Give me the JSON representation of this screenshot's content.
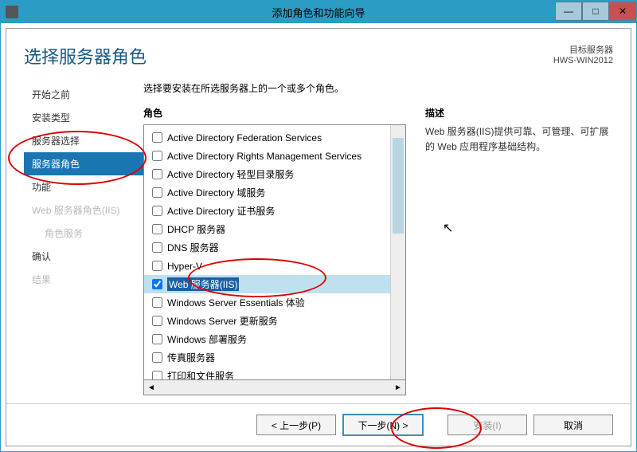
{
  "window": {
    "title": "添加角色和功能向导",
    "wizard_title": "选择服务器角色",
    "target_label": "目标服务器",
    "target_server": "HWS-WIN2012"
  },
  "nav": {
    "items": [
      {
        "label": "开始之前",
        "state": "done"
      },
      {
        "label": "安装类型",
        "state": "done"
      },
      {
        "label": "服务器选择",
        "state": "done"
      },
      {
        "label": "服务器角色",
        "state": "active"
      },
      {
        "label": "功能",
        "state": "done"
      },
      {
        "label": "Web 服务器角色(IIS)",
        "state": "disabled"
      },
      {
        "label": "角色服务",
        "state": "disabled",
        "sub": true
      },
      {
        "label": "确认",
        "state": "done"
      },
      {
        "label": "结果",
        "state": "disabled"
      }
    ]
  },
  "main": {
    "instruction": "选择要安装在所选服务器上的一个或多个角色。",
    "roles_header": "角色",
    "desc_header": "描述",
    "desc_text": "Web 服务器(IIS)提供可靠、可管理、可扩展的 Web 应用程序基础结构。",
    "roles": [
      {
        "label": "Active Directory Federation Services",
        "checked": false
      },
      {
        "label": "Active Directory Rights Management Services",
        "checked": false
      },
      {
        "label": "Active Directory 轻型目录服务",
        "checked": false
      },
      {
        "label": "Active Directory 域服务",
        "checked": false
      },
      {
        "label": "Active Directory 证书服务",
        "checked": false
      },
      {
        "label": "DHCP 服务器",
        "checked": false
      },
      {
        "label": "DNS 服务器",
        "checked": false
      },
      {
        "label": "Hyper-V",
        "checked": false
      },
      {
        "label": "Web 服务器(IIS)",
        "checked": true,
        "selected": true
      },
      {
        "label": "Windows Server Essentials 体验",
        "checked": false
      },
      {
        "label": "Windows Server 更新服务",
        "checked": false
      },
      {
        "label": "Windows 部署服务",
        "checked": false
      },
      {
        "label": "传真服务器",
        "checked": false
      },
      {
        "label": "打印和文件服务",
        "checked": false
      }
    ]
  },
  "footer": {
    "prev": "< 上一步(P)",
    "next": "下一步(N) >",
    "install": "安装(I)",
    "cancel": "取消"
  }
}
